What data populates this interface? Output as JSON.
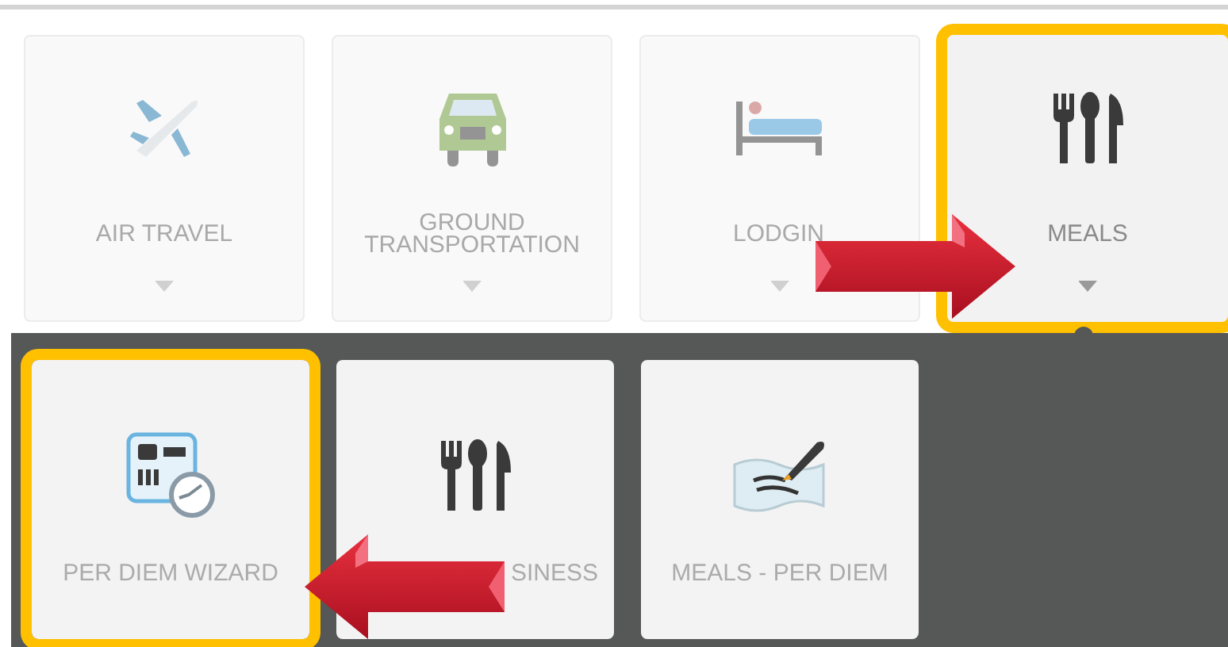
{
  "categories": [
    {
      "label": "AIR TRAVEL",
      "kind": "plane",
      "selected": false,
      "highlighted": false
    },
    {
      "label": "GROUND TRANSPORTATION",
      "kind": "car",
      "selected": false,
      "highlighted": false
    },
    {
      "label": "LODGIN",
      "kind": "bed",
      "selected": false,
      "highlighted": false
    },
    {
      "label": "MEALS",
      "kind": "cutlery",
      "selected": true,
      "highlighted": true
    }
  ],
  "subcategories": [
    {
      "label": "PER DIEM WIZARD",
      "kind": "wizard",
      "highlighted": true
    },
    {
      "label": "SINESS",
      "kind": "cutlery",
      "highlighted": false
    },
    {
      "label": "MEALS - PER DIEM",
      "kind": "pen",
      "highlighted": false
    }
  ]
}
